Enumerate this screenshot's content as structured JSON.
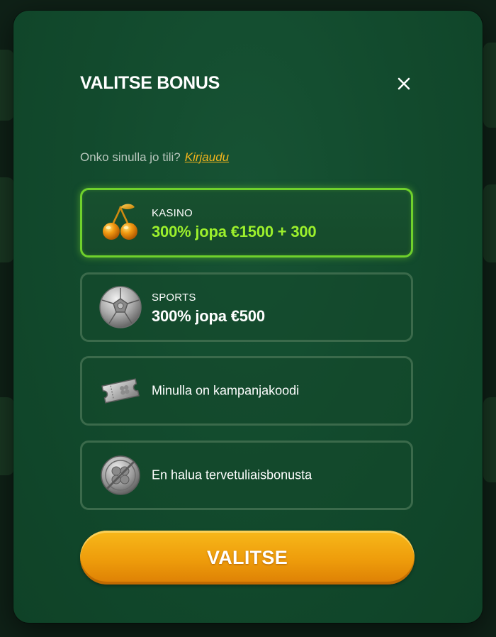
{
  "modal": {
    "title": "VALITSE BONUS",
    "close_icon": "close-icon"
  },
  "login": {
    "prompt": "Onko sinulla jo tili?",
    "link": "Kirjaudu"
  },
  "options": [
    {
      "icon": "cherries-icon",
      "category": "KASINO",
      "offer": "300% jopa €1500 + 300",
      "selected": true
    },
    {
      "icon": "sports-ball-icon",
      "category": "SPORTS",
      "offer": "300% jopa €500",
      "selected": false
    },
    {
      "icon": "ticket-icon",
      "label": "Minulla on kampanjakoodi",
      "selected": false
    },
    {
      "icon": "clover-coin-icon",
      "label": "En halua tervetuliaisbonusta",
      "selected": false
    }
  ],
  "submit": {
    "label": "VALITSE"
  },
  "colors": {
    "modal_bg": "#124a2d",
    "accent_green": "#9cf02c",
    "selected_border": "#6fd12c",
    "link": "#f2b51c",
    "button": "#f0a010"
  }
}
